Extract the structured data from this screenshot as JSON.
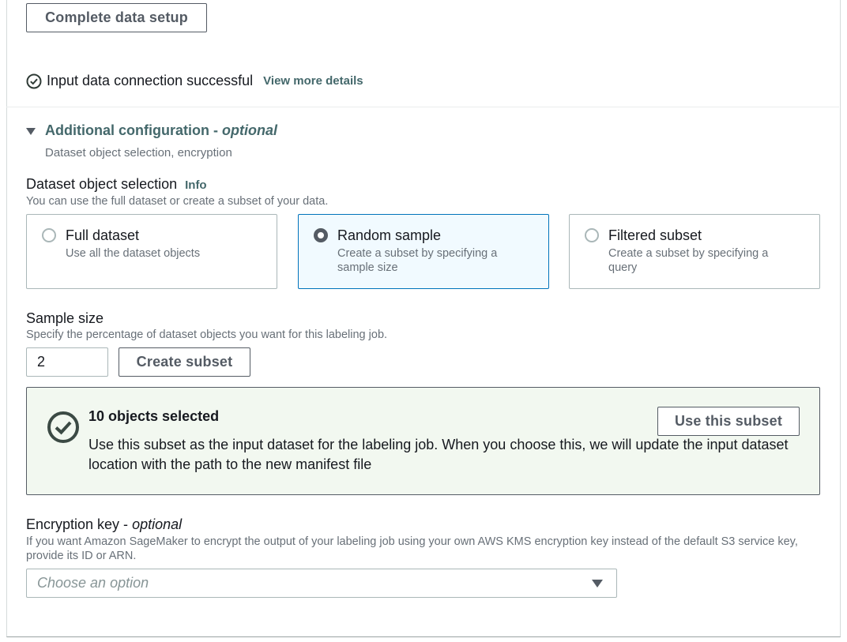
{
  "setup": {
    "complete_label": "Complete data setup"
  },
  "connection": {
    "status_text": "Input data connection successful",
    "details_link": "View more details",
    "icon": "check-circle-icon"
  },
  "additional_config": {
    "title": "Additional configuration -",
    "title_optional": "optional",
    "description": "Dataset object selection, encryption",
    "expanded": true
  },
  "dataset_selection": {
    "label": "Dataset object selection",
    "info": "Info",
    "description": "You can use the full dataset or create a subset of your data.",
    "options": [
      {
        "title": "Full dataset",
        "description": "Use all the dataset objects",
        "selected": false
      },
      {
        "title": "Random sample",
        "description": "Create a subset by specifying a sample size",
        "selected": true
      },
      {
        "title": "Filtered subset",
        "description": "Create a subset by specifying a query",
        "selected": false
      }
    ]
  },
  "sample_size": {
    "label": "Sample size",
    "description": "Specify the percentage of dataset objects you want for this labeling job.",
    "value": "2",
    "create_label": "Create subset"
  },
  "subset_alert": {
    "title": "10 objects selected",
    "body": "Use this subset as the input dataset for the labeling job. When you choose this, we will update the input dataset location with the path to the new manifest file",
    "use_label": "Use this subset",
    "icon": "check-circle-icon"
  },
  "encryption": {
    "label": "Encryption key -",
    "label_optional": "optional",
    "description": "If you want Amazon SageMaker to encrypt the output of your labeling job using your own AWS KMS encryption key instead of the default S3 service key, provide its ID or ARN.",
    "placeholder": "Choose an option"
  },
  "colors": {
    "link": "#44686b",
    "selected_tile_bg": "#f1faff",
    "selected_tile_border": "#0073bb",
    "success_bg": "#f2f8f0",
    "success_icon": "#3b4a44"
  }
}
